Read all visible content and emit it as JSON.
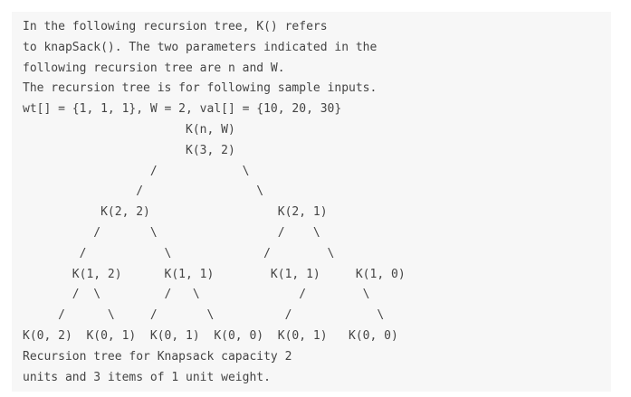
{
  "code_lines": [
    "In the following recursion tree, K() refers",
    "to knapSack(). The two parameters indicated in the",
    "following recursion tree are n and W.",
    "The recursion tree is for following sample inputs.",
    "wt[] = {1, 1, 1}, W = 2, val[] = {10, 20, 30}",
    "                       K(n, W)",
    "                       K(3, 2)",
    "                  /            \\",
    "                /                \\",
    "           K(2, 2)                  K(2, 1)",
    "          /       \\                 /    \\",
    "        /           \\             /        \\",
    "       K(1, 2)      K(1, 1)        K(1, 1)     K(1, 0)",
    "       /  \\         /   \\              /        \\",
    "     /      \\     /       \\          /            \\",
    "K(0, 2)  K(0, 1)  K(0, 1)  K(0, 0)  K(0, 1)   K(0, 0)",
    "Recursion tree for Knapsack capacity 2",
    "units and 3 items of 1 unit weight."
  ]
}
